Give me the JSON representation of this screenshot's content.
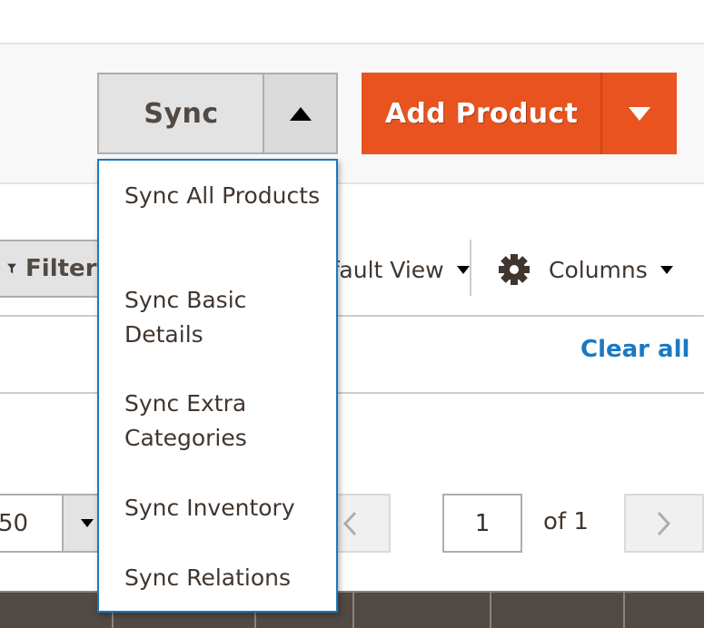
{
  "page_actions": {
    "sync_button": {
      "label": "Sync",
      "toggle_state": "open"
    },
    "add_product_button": {
      "label": "Add Product"
    }
  },
  "sync_menu": {
    "items": [
      {
        "label": "Sync All Products"
      },
      {
        "label": "Sync Basic Details"
      },
      {
        "label": "Sync Extra Categories"
      },
      {
        "label": "Sync Inventory"
      },
      {
        "label": "Sync Relations"
      }
    ]
  },
  "toolbar": {
    "filters_label": "Filters",
    "view_label": "Default View",
    "columns_label": "Columns",
    "clear_all_label": "Clear all"
  },
  "pagination": {
    "per_page_value": "50",
    "current_page": "1",
    "page_total_text": "of 1"
  },
  "colors": {
    "primary_orange": "#e8531f",
    "link_blue": "#1979c3",
    "grid_header": "#514943"
  }
}
